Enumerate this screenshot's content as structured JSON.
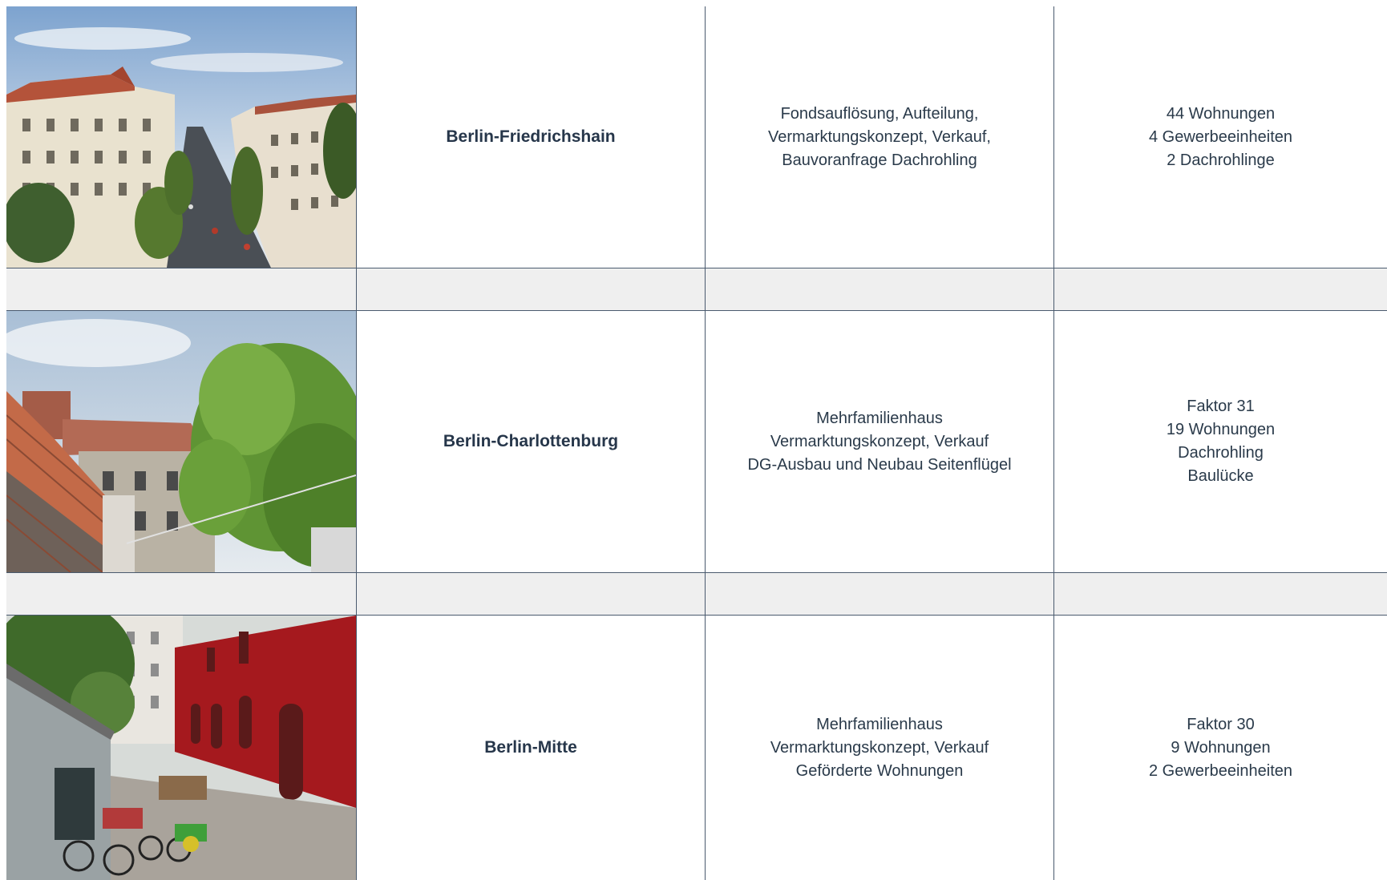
{
  "rows": [
    {
      "location": "Berlin-Friedrichshain",
      "scope": [
        "Fondsauflösung, Aufteilung,",
        "Vermarktungskonzept, Verkauf,",
        "Bauvoranfrage Dachrohling"
      ],
      "details": [
        "44 Wohnungen",
        "4 Gewerbeeinheiten",
        "2 Dachrohlinge"
      ]
    },
    {
      "location": "Berlin-Charlottenburg",
      "scope": [
        "Mehrfamilienhaus",
        "Vermarktungskonzept, Verkauf",
        "DG-Ausbau und Neubau Seitenflügel"
      ],
      "details": [
        "Faktor 31",
        "19 Wohnungen",
        "Dachrohling",
        "Baulücke"
      ]
    },
    {
      "location": "Berlin-Mitte",
      "scope": [
        "Mehrfamilienhaus",
        "Vermarktungskonzept, Verkauf",
        "Geförderte Wohnungen"
      ],
      "details": [
        "Faktor 30",
        "9 Wohnungen",
        "2 Gewerbeeinheiten"
      ]
    }
  ]
}
